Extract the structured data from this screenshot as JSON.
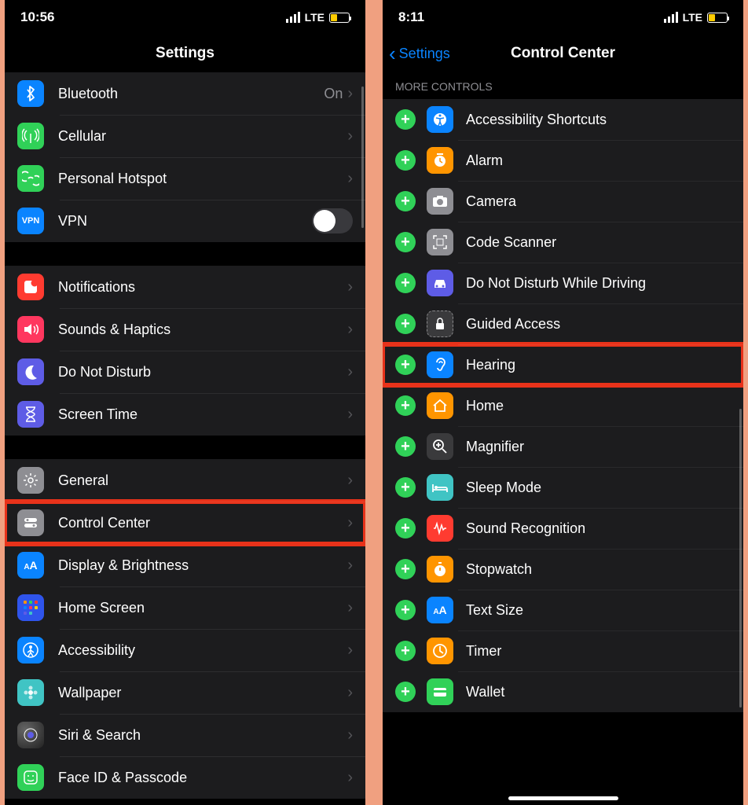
{
  "left": {
    "status": {
      "time": "10:56",
      "carrier": "LTE"
    },
    "header": {
      "title": "Settings"
    },
    "groups": [
      {
        "items": [
          {
            "id": "bluetooth",
            "label": "Bluetooth",
            "value": "On",
            "icon_bg": "#0a84ff",
            "glyph": "bluetooth",
            "chevron": true
          },
          {
            "id": "cellular",
            "label": "Cellular",
            "icon_bg": "#30d158",
            "glyph": "antenna",
            "chevron": true
          },
          {
            "id": "hotspot",
            "label": "Personal Hotspot",
            "icon_bg": "#30d158",
            "glyph": "link",
            "chevron": true
          },
          {
            "id": "vpn",
            "label": "VPN",
            "icon_bg": "#0a84ff",
            "glyph": "VPN",
            "toggle": true
          }
        ]
      },
      {
        "items": [
          {
            "id": "notifications",
            "label": "Notifications",
            "icon_bg": "#ff3b30",
            "glyph": "notif",
            "chevron": true
          },
          {
            "id": "sounds",
            "label": "Sounds & Haptics",
            "icon_bg": "#ff375f",
            "glyph": "sound",
            "chevron": true
          },
          {
            "id": "dnd",
            "label": "Do Not Disturb",
            "icon_bg": "#5e5ce6",
            "glyph": "moon",
            "chevron": true
          },
          {
            "id": "screentime",
            "label": "Screen Time",
            "icon_bg": "#5e5ce6",
            "glyph": "hourglass",
            "chevron": true
          }
        ]
      },
      {
        "items": [
          {
            "id": "general",
            "label": "General",
            "icon_bg": "#8e8e93",
            "glyph": "gear",
            "chevron": true
          },
          {
            "id": "controlcenter",
            "label": "Control Center",
            "icon_bg": "#8e8e93",
            "glyph": "switches",
            "chevron": true,
            "highlight": true
          },
          {
            "id": "display",
            "label": "Display & Brightness",
            "icon_bg": "#0a84ff",
            "glyph": "AA",
            "chevron": true
          },
          {
            "id": "homescreen",
            "label": "Home Screen",
            "icon_bg": "#2f54eb",
            "glyph": "grid",
            "chevron": true
          },
          {
            "id": "accessibility",
            "label": "Accessibility",
            "icon_bg": "#0a84ff",
            "glyph": "person",
            "chevron": true
          },
          {
            "id": "wallpaper",
            "label": "Wallpaper",
            "icon_bg": "#40c4c4",
            "glyph": "flower",
            "chevron": true
          },
          {
            "id": "siri",
            "label": "Siri & Search",
            "icon_bg": "gradient",
            "glyph": "siri",
            "chevron": true
          },
          {
            "id": "faceid",
            "label": "Face ID & Passcode",
            "icon_bg": "#30d158",
            "glyph": "face",
            "chevron": true
          }
        ]
      }
    ]
  },
  "right": {
    "status": {
      "time": "8:11",
      "carrier": "LTE"
    },
    "header": {
      "back": "Settings",
      "title": "Control Center"
    },
    "section_header": "MORE CONTROLS",
    "controls": [
      {
        "id": "accessibility-shortcuts",
        "label": "Accessibility Shortcuts",
        "icon_bg": "#0a84ff",
        "glyph": "access"
      },
      {
        "id": "alarm",
        "label": "Alarm",
        "icon_bg": "#ff9500",
        "glyph": "clock"
      },
      {
        "id": "camera",
        "label": "Camera",
        "icon_bg": "#8e8e93",
        "glyph": "camera"
      },
      {
        "id": "code-scanner",
        "label": "Code Scanner",
        "icon_bg": "#8e8e93",
        "glyph": "qr"
      },
      {
        "id": "dnd-driving",
        "label": "Do Not Disturb While Driving",
        "icon_bg": "#5e5ce6",
        "glyph": "car"
      },
      {
        "id": "guided-access",
        "label": "Guided Access",
        "icon_bg": "#3a3a3c",
        "glyph": "lock"
      },
      {
        "id": "hearing",
        "label": "Hearing",
        "icon_bg": "#0a84ff",
        "glyph": "ear",
        "highlight": true
      },
      {
        "id": "home",
        "label": "Home",
        "icon_bg": "#ff9500",
        "glyph": "home"
      },
      {
        "id": "magnifier",
        "label": "Magnifier",
        "icon_bg": "#3a3a3c",
        "glyph": "magnify"
      },
      {
        "id": "sleep-mode",
        "label": "Sleep Mode",
        "icon_bg": "#40c4c4",
        "glyph": "bed"
      },
      {
        "id": "sound-recognition",
        "label": "Sound Recognition",
        "icon_bg": "#ff3b30",
        "glyph": "wave"
      },
      {
        "id": "stopwatch",
        "label": "Stopwatch",
        "icon_bg": "#ff9500",
        "glyph": "stopwatch"
      },
      {
        "id": "text-size",
        "label": "Text Size",
        "icon_bg": "#0a84ff",
        "glyph": "AA"
      },
      {
        "id": "timer",
        "label": "Timer",
        "icon_bg": "#ff9500",
        "glyph": "timer"
      },
      {
        "id": "wallet",
        "label": "Wallet",
        "icon_bg": "#30d158",
        "glyph": "wallet"
      }
    ]
  }
}
